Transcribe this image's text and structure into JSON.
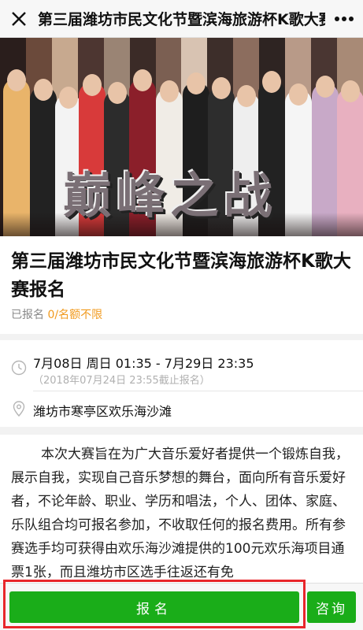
{
  "topbar": {
    "title": "第三届潍坊市民文化节暨滨海旅游杯K歌大赛报名",
    "close_icon": "close-icon",
    "more_icon": "more-icon"
  },
  "banner": {
    "slogan": "巅峰之战"
  },
  "event": {
    "title": "第三届潍坊市民文化节暨滨海旅游杯K歌大赛报名",
    "registered_label": "已报名 ",
    "registered_count": "0",
    "quota": "/名额不限"
  },
  "schedule": {
    "time_range": "7月08日 周日 01:35 - 7月29日 23:35",
    "deadline": "（2018年07月24日 23:55截止报名）",
    "location": "潍坊市寒亭区欢乐海沙滩"
  },
  "description": {
    "text": "本次大赛旨在为广大音乐爱好者提供一个锻炼自我，展示自我，实现自己音乐梦想的舞台，面向所有音乐爱好者，不论年龄、职业、学历和唱法，个人、团体、家庭、乐队组合均可报名参加，不收取任何的报名费用。所有参赛选手均可获得由欢乐海沙滩提供的100元欢乐海项目通票1张，而且潍坊市区选手往返还有免"
  },
  "actions": {
    "signup_label": "报名",
    "consult_label": "咨询"
  },
  "colors": {
    "primary_green": "#1aad19",
    "accent_orange": "#f19a1e",
    "highlight_red": "#e8262b"
  }
}
